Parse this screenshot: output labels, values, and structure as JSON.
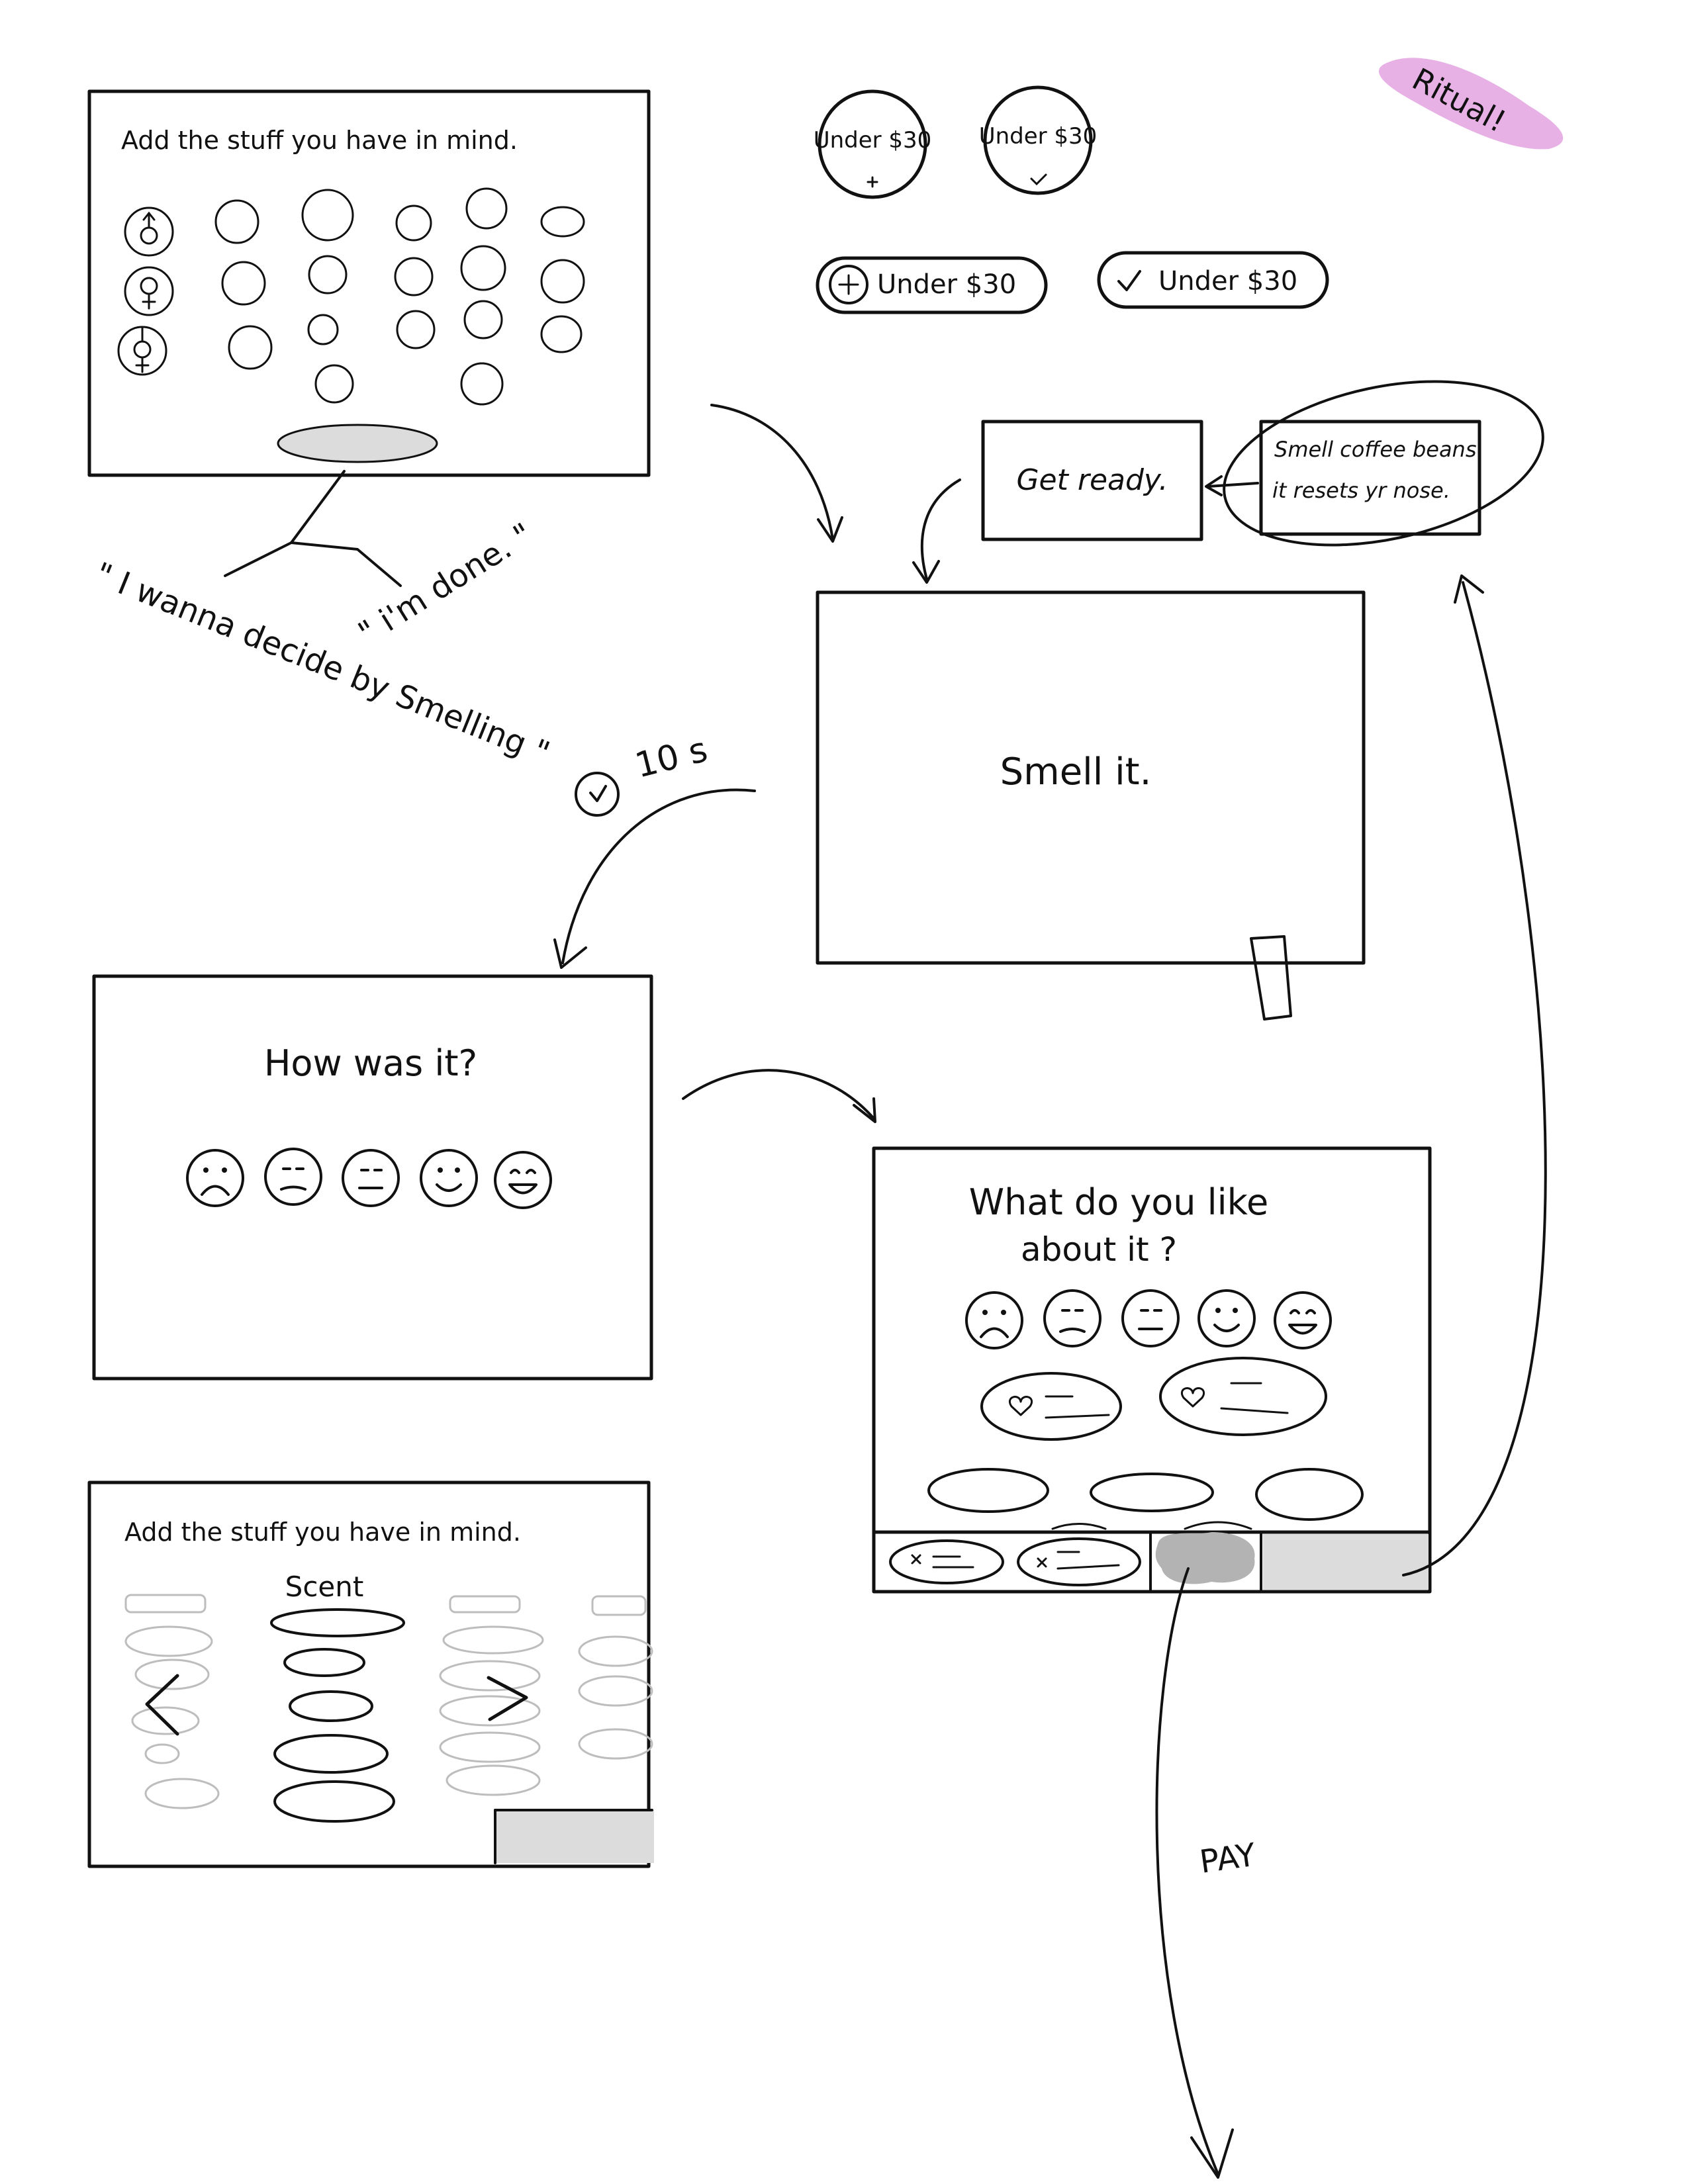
{
  "colors": {
    "ink": "#111111",
    "panel_grey": "#dcdcdc",
    "dark_grey": "#b3b3b3",
    "ghost_grey": "#bdbdbd",
    "highlighter_pink": "#e3a3e0"
  },
  "screen_add_stuff": {
    "title": "Add the stuff you have in mind.",
    "icons": [
      "male-symbol-icon",
      "female-symbol-icon",
      "transgender-symbol-icon"
    ]
  },
  "branch_notes": {
    "decide_by_smelling": "\" I wanna decide by Smelling \"",
    "im_done": "\" i'm done. \""
  },
  "chip_variants": {
    "circle_unselected": "Under $30",
    "circle_selected": "Under $30",
    "pill_unselected": "Under $30",
    "pill_selected": "Under $30",
    "plus_icon": "plus-icon",
    "check_icon": "check-icon"
  },
  "ritual_tag": "Ritual!",
  "get_ready_card": {
    "text": "Get ready."
  },
  "tip_card": {
    "line1": "Smell coffee beans",
    "line2": "it resets yr nose."
  },
  "screen_smell": {
    "text": "Smell it."
  },
  "timer": {
    "label": "10 s",
    "icon": "clock-icon"
  },
  "screen_how_was_it": {
    "title": "How was it?",
    "faces": [
      "very-sad-face-icon",
      "sad-face-icon",
      "neutral-face-icon",
      "smile-face-icon",
      "happy-face-icon"
    ]
  },
  "screen_what_like": {
    "title_line1": "What do you like",
    "title_line2": "about it ?",
    "faces": [
      "very-sad-face-icon",
      "sad-face-icon",
      "neutral-face-icon",
      "smile-face-icon",
      "happy-face-icon"
    ],
    "selected_face_index": 3
  },
  "screen_scent_picker": {
    "title": "Add the stuff you have in mind.",
    "column_label": "Scent",
    "prev_icon": "chevron-left-icon",
    "next_icon": "chevron-right-icon"
  },
  "pay_label": "PAY"
}
